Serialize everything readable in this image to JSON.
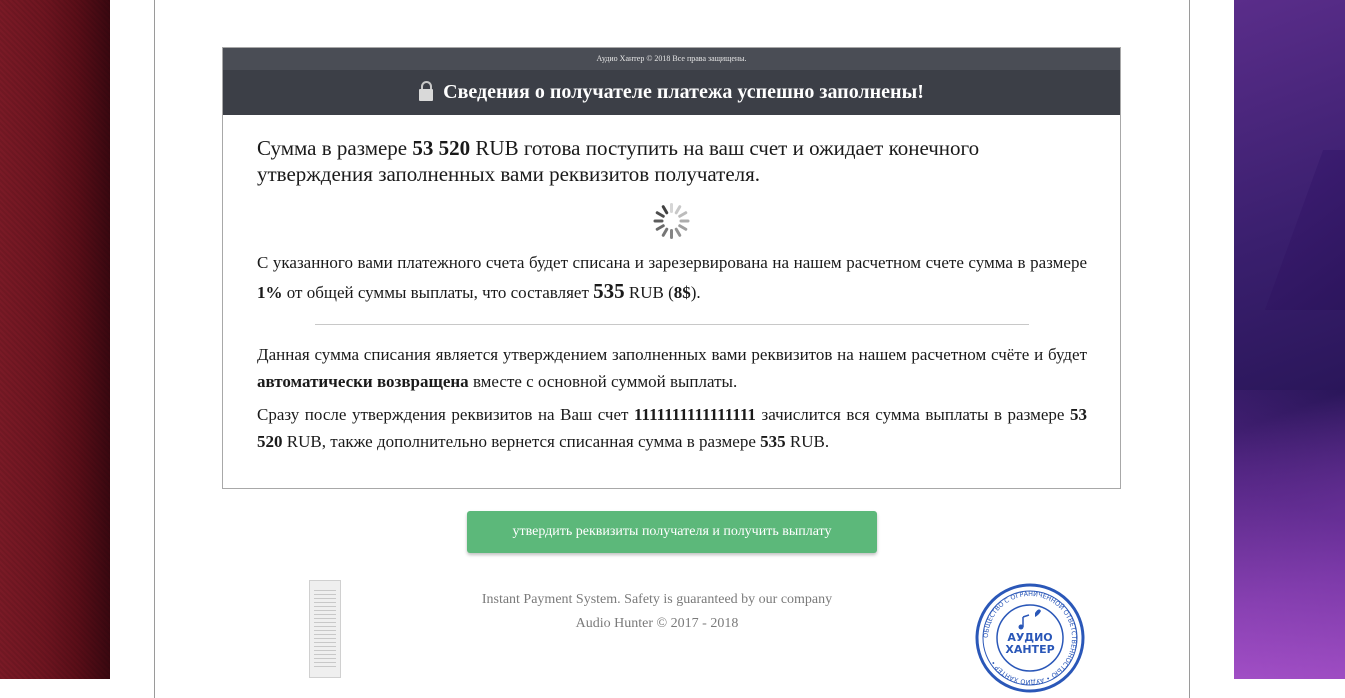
{
  "card": {
    "copyright_strip": "Аудио Хантер © 2018 Все права защищены.",
    "title": "Сведения о получателе платежа успешно заполнены!",
    "lead": {
      "pre": "Сумма в размере ",
      "amount": "53 520",
      "post": " RUB готова поступить на ваш счет и ожидает конечного утверждения заполненных вами реквизитов получателя."
    },
    "p1": {
      "pre": "С указанного вами платежного счета будет списана и зарезервирована на нашем расчетном счете сумма в размере ",
      "percent": "1%",
      "mid": " от общей суммы выплаты, что составляет ",
      "fee": "535",
      "rub": " RUB (",
      "usd": "8$",
      "end": ")."
    },
    "p3": {
      "pre": "Данная сумма списания является утверждением заполненных вами реквизитов на нашем расчетном счёте и будет ",
      "bold": "автоматически возвращена",
      "post": " вместе с основной суммой выплаты."
    },
    "p4": {
      "pre": "Сразу после утверждения реквизитов на Ваш счет ",
      "account": "1111111111111111",
      "mid": " зачислится вся сумма выплаты в размере ",
      "amount": "53 520",
      "mid2": " RUB, также дополнительно вернется списанная сумма в размере ",
      "fee": "535",
      "end": " RUB."
    }
  },
  "cta_label": "утвердить реквизиты получателя и получить выплату",
  "footer": {
    "line1": "Instant Payment System. Safety is guaranteed by our company",
    "line2": "Audio Hunter © 2017 - 2018"
  },
  "stamp": {
    "line1": "АУДИО",
    "line2": "ХАНТЕР",
    "ring_text": "ОБЩЕСТВО С ОГРАНИЧЕННОЙ ОТВЕТСТВЕННОСТЬЮ • АУДИО ХАНТЕР •"
  },
  "colors": {
    "header_bg": "#3c3f47",
    "cta_bg": "#5cb87a",
    "stamp_blue": "#2a57b8"
  }
}
